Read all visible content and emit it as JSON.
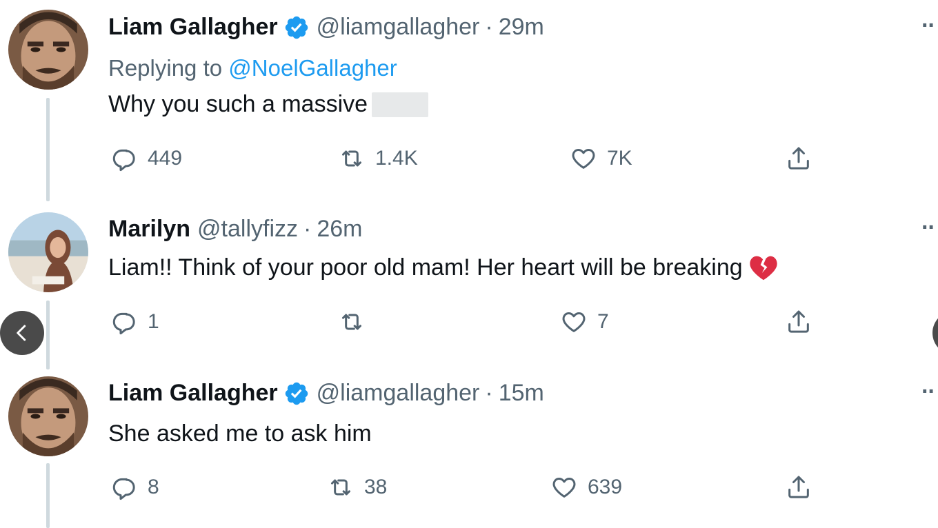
{
  "tweets": [
    {
      "name": "Liam Gallagher",
      "verified": true,
      "handle": "@liamgallagher",
      "separator": "·",
      "time": "29m",
      "replying_prefix": "Replying to",
      "replying_to": "@NoelGallagher",
      "text": "Why you such a massive",
      "redacted_word": true,
      "replies": "449",
      "retweets": "1.4K",
      "likes": "7K"
    },
    {
      "name": "Marilyn",
      "verified": false,
      "handle": "@tallyfizz",
      "separator": "·",
      "time": "26m",
      "text": "Liam!! Think of your poor old mam! Her heart will be breaking",
      "emoji": "broken-heart",
      "replies": "1",
      "retweets": "",
      "likes": "7"
    },
    {
      "name": "Liam Gallagher",
      "verified": true,
      "handle": "@liamgallagher",
      "separator": "·",
      "time": "15m",
      "text": "She asked me to ask him",
      "replies": "8",
      "retweets": "38",
      "likes": "639"
    }
  ],
  "more_label": "··",
  "icons": {
    "reply": "reply-icon",
    "retweet": "retweet-icon",
    "like": "heart-icon",
    "share": "share-icon",
    "verified": "verified-badge-icon",
    "prev": "chevron-left-icon"
  },
  "colors": {
    "link": "#1d9bf0",
    "secondary": "#536471",
    "verified": "#1d9bf0",
    "broken_heart": "#dd2e44"
  }
}
